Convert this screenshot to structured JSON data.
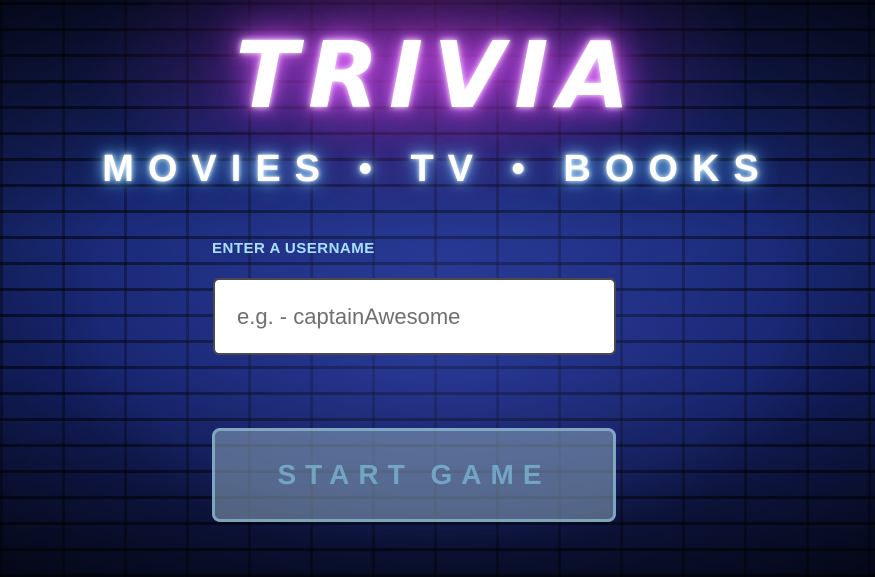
{
  "header": {
    "title": "TRIVIA",
    "subtitle": "MOVIES • TV • BOOKS"
  },
  "form": {
    "username_label": "ENTER A USERNAME",
    "username_placeholder": "e.g. - captainAwesome",
    "username_value": "",
    "start_button_label": "START GAME",
    "start_button_disabled": true
  },
  "colors": {
    "title_glow": "#c24be6",
    "subtitle_glow": "#4aa8ff",
    "label": "#a9e0ff",
    "button_bg": "#8ca5b9"
  }
}
